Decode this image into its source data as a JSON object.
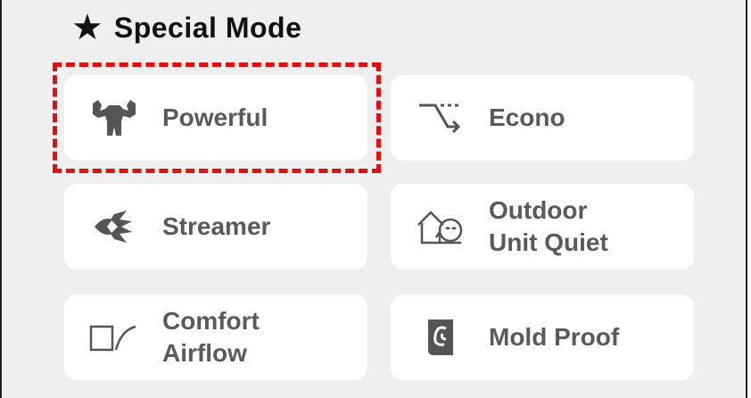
{
  "header": {
    "star_glyph": "★",
    "title": "Special Mode"
  },
  "modes": {
    "powerful": {
      "label": "Powerful",
      "icon": "muscle-icon"
    },
    "econo": {
      "label": "Econo",
      "icon": "econo-icon"
    },
    "streamer": {
      "label": "Streamer",
      "icon": "streamer-icon"
    },
    "outdoor_quiet": {
      "label": "Outdoor\nUnit Quiet",
      "icon": "quiet-house-icon"
    },
    "comfort_airflow": {
      "label": "Comfort\nAirflow",
      "icon": "airflow-icon"
    },
    "mold_proof": {
      "label": "Mold Proof",
      "icon": "mold-proof-icon"
    }
  },
  "colors": {
    "highlight": "#e01010",
    "icon": "#555555",
    "label": "#5a5a5a",
    "panel": "#efefef"
  }
}
